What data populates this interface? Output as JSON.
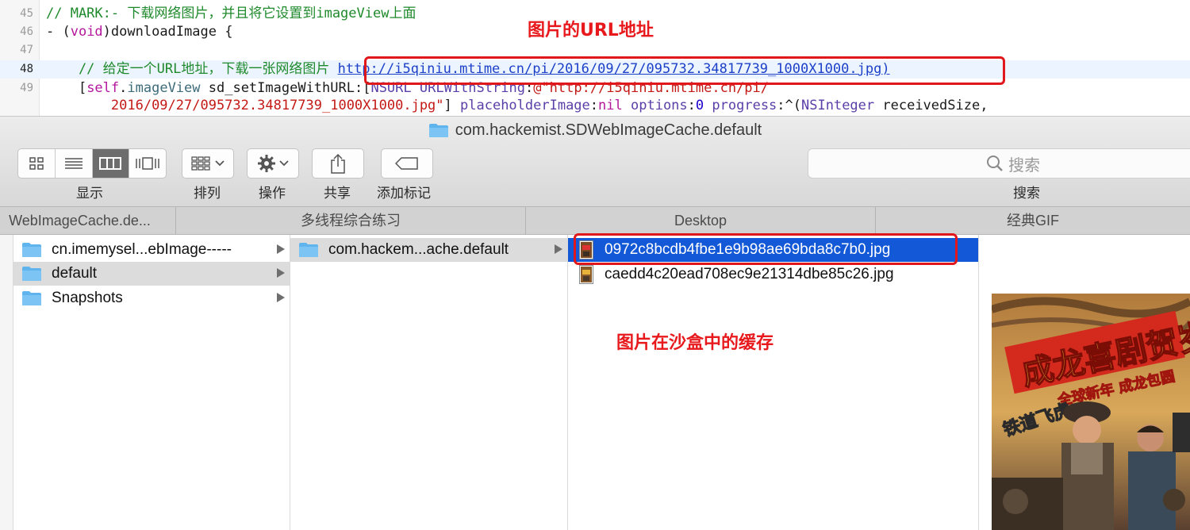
{
  "editor": {
    "lines": [
      {
        "num": "45",
        "segments": [
          {
            "text": "// MARK:- 下载网络图片，并且将它设置到imageView上面",
            "cls": "c-comment"
          }
        ]
      },
      {
        "num": "46",
        "segments": [
          {
            "text": "- (",
            "cls": "c-plain"
          },
          {
            "text": "void",
            "cls": "c-kw"
          },
          {
            "text": ")downloadImage {",
            "cls": "c-plain"
          }
        ]
      },
      {
        "num": "47",
        "segments": []
      },
      {
        "num": "48",
        "current": true,
        "segments": [
          {
            "text": "    // 给定一个URL地址，下载一张网络图片 ",
            "cls": "c-comment"
          },
          {
            "text": "http://i5qiniu.mtime.cn/pi/2016/09/27/095732.34817739_1000X1000.jpg)",
            "cls": "c-link"
          }
        ]
      },
      {
        "num": "49",
        "segments": [
          {
            "text": "    [",
            "cls": "c-plain"
          },
          {
            "text": "self",
            "cls": "c-kw"
          },
          {
            "text": ".",
            "cls": "c-plain"
          },
          {
            "text": "imageView",
            "cls": "c-method"
          },
          {
            "text": " sd_setImageWithURL:[",
            "cls": "c-plain"
          },
          {
            "text": "NSURL",
            "cls": "c-class"
          },
          {
            "text": " ",
            "cls": "c-plain"
          },
          {
            "text": "URLWithString",
            "cls": "c-class"
          },
          {
            "text": ":",
            "cls": "c-plain"
          },
          {
            "text": "@\"http://i5qiniu.mtime.cn/pi/",
            "cls": "c-string"
          }
        ]
      },
      {
        "num": "",
        "segments": [
          {
            "text": "        ",
            "cls": "c-plain"
          },
          {
            "text": "2016/09/27/095732.34817739_1000X1000.jpg\"",
            "cls": "c-string"
          },
          {
            "text": "] ",
            "cls": "c-plain"
          },
          {
            "text": "placeholderImage",
            "cls": "c-class"
          },
          {
            "text": ":",
            "cls": "c-plain"
          },
          {
            "text": "nil",
            "cls": "c-kw"
          },
          {
            "text": " ",
            "cls": "c-plain"
          },
          {
            "text": "options",
            "cls": "c-class"
          },
          {
            "text": ":",
            "cls": "c-plain"
          },
          {
            "text": "0",
            "cls": "c-num"
          },
          {
            "text": " ",
            "cls": "c-plain"
          },
          {
            "text": "progress",
            "cls": "c-class"
          },
          {
            "text": ":^(",
            "cls": "c-plain"
          },
          {
            "text": "NSInteger",
            "cls": "c-class"
          },
          {
            "text": " receivedSize,",
            "cls": "c-plain"
          }
        ]
      }
    ]
  },
  "annotations": {
    "url_label": "图片的URL地址",
    "cache_label": "图片在沙盒中的缓存"
  },
  "window": {
    "title": "com.hackemist.SDWebImageCache.default"
  },
  "toolbar": {
    "view_label": "显示",
    "arrange_label": "排列",
    "action_label": "操作",
    "share_label": "共享",
    "tags_label": "添加标记",
    "search_placeholder": "搜索",
    "search_label": "搜索"
  },
  "tabs": [
    {
      "label": "WebImageCache.de...",
      "active": true
    },
    {
      "label": "多线程综合练习",
      "active": false
    },
    {
      "label": "Desktop",
      "active": false
    },
    {
      "label": "经典GIF",
      "active": false
    }
  ],
  "column1": {
    "items": [
      {
        "label": "cn.imemysel...ebImage-----",
        "selected": false
      },
      {
        "label": "default",
        "selected": true
      },
      {
        "label": "Snapshots",
        "selected": false
      }
    ]
  },
  "column2": {
    "items": [
      {
        "label": "com.hackem...ache.default",
        "selected": true
      }
    ]
  },
  "column3": {
    "items": [
      {
        "label": "0972c8bcdb4fbe1e9b98ae69bda8c7b0.jpg",
        "selected": true
      },
      {
        "label": "caedd4c20ead708ec9e21314dbe85c26.jpg",
        "selected": false
      }
    ]
  },
  "preview": {
    "title_text": "成龙喜剧贺岁",
    "subtitle_text": "全球新年 成龙包圆",
    "corner_text": "铁道飞虎",
    "colors": {
      "sky": "#c99a4f",
      "banner": "#d42a1e",
      "ground": "#3b2f24",
      "yellow": "#f3d23a"
    }
  },
  "colors": {
    "selection_blue": "#1358d6",
    "annotation_red": "#e0181b",
    "folder_blue": "#5fb4ee"
  }
}
